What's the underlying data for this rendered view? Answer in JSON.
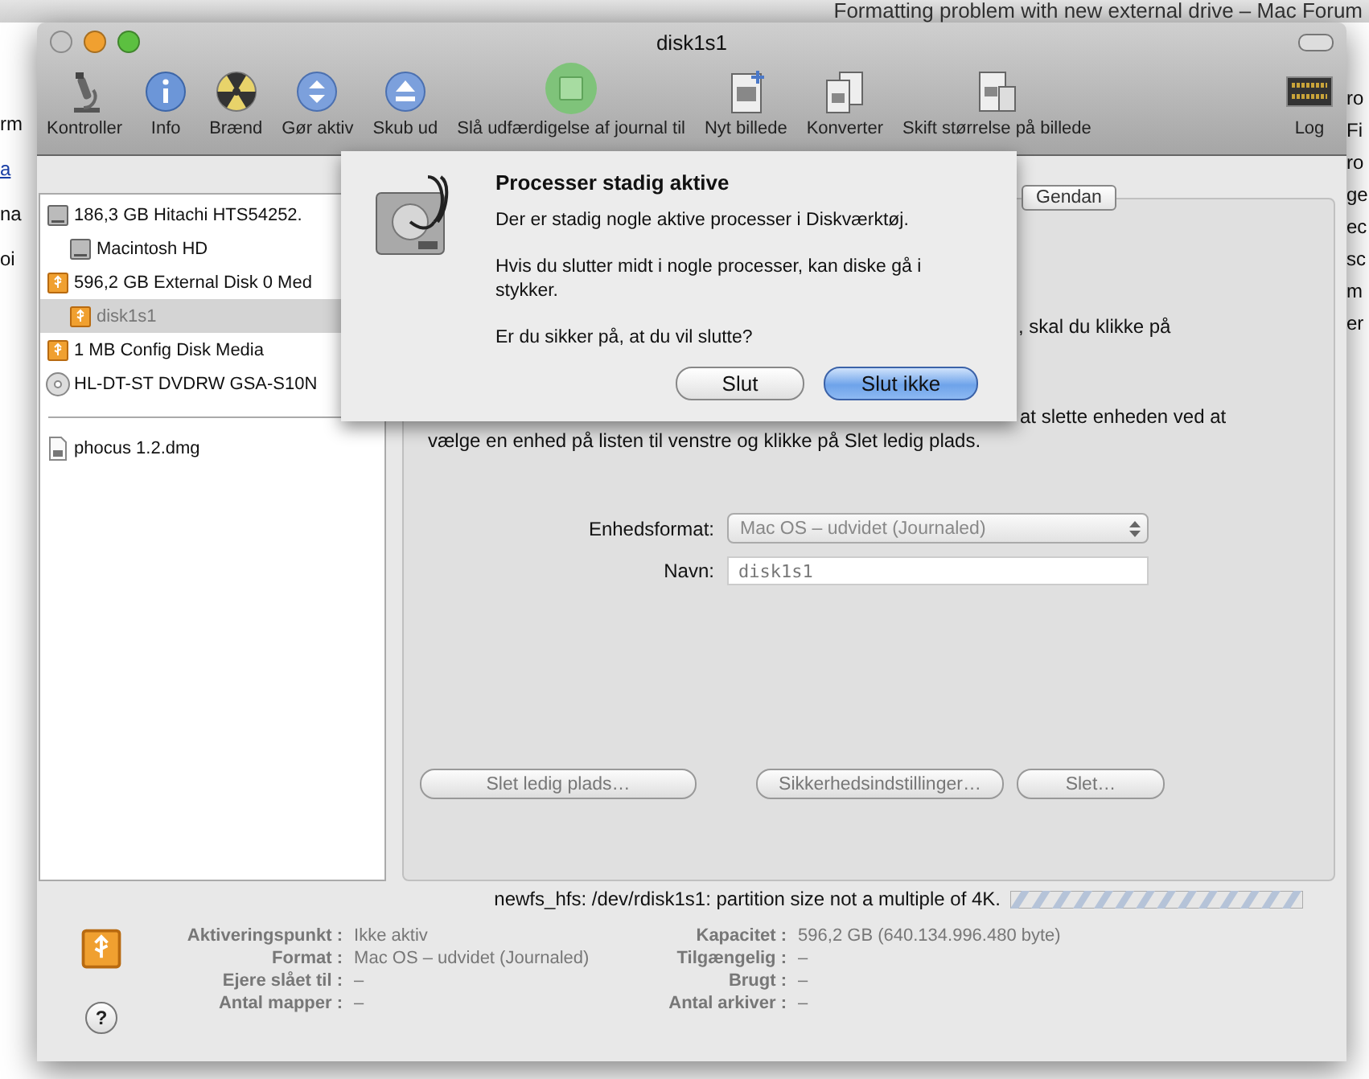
{
  "background_window": {
    "title": "Formatting problem with new external drive – Mac Forum",
    "left_fragments": [
      {
        "text": "rm",
        "kind": "text"
      },
      {
        "text": "a",
        "kind": "link"
      },
      {
        "text": "na",
        "kind": "text"
      },
      {
        "text": "oi",
        "kind": "text"
      }
    ],
    "right_fragments": [
      "ro",
      "Fi",
      "ro",
      "ge",
      "ec",
      "sc",
      "m",
      "er"
    ]
  },
  "window": {
    "title": "disk1s1"
  },
  "toolbar": [
    {
      "label": "Kontroller",
      "kind": "microscope"
    },
    {
      "label": "Info",
      "kind": "info"
    },
    {
      "label": "Brænd",
      "kind": "burn"
    },
    {
      "label": "Gør aktiv",
      "kind": "mount"
    },
    {
      "label": "Skub ud",
      "kind": "eject"
    },
    {
      "label": "Slå udfærdigelse af journal til",
      "kind": "journal"
    },
    {
      "label": "Nyt billede",
      "kind": "newimage"
    },
    {
      "label": "Konverter",
      "kind": "convert"
    },
    {
      "label": "Skift størrelse på billede",
      "kind": "resize"
    },
    {
      "label": "Log",
      "kind": "log"
    }
  ],
  "sidebar": {
    "items": [
      {
        "label": "186,3 GB Hitachi HTS54252.",
        "kind": "hdd",
        "selected": false,
        "children": [
          {
            "label": "Macintosh HD",
            "kind": "hdd",
            "selected": false
          }
        ]
      },
      {
        "label": "596,2 GB External Disk 0 Med",
        "kind": "usb",
        "selected": false,
        "children": [
          {
            "label": "disk1s1",
            "kind": "usb",
            "selected": true
          }
        ]
      },
      {
        "label": "1 MB Config Disk Media",
        "kind": "usb",
        "selected": false
      },
      {
        "label": "HL-DT-ST DVDRW GSA-S10N",
        "kind": "optical",
        "selected": false
      }
    ],
    "images": [
      {
        "label": "phocus 1.2.dmg",
        "kind": "dmg",
        "selected": false
      }
    ]
  },
  "tabs": [
    {
      "label": "Gendan",
      "selected": false
    }
  ],
  "panel": {
    "instruction_fragment": ", skal du klikke på",
    "note_lines": [
      "at slette enheden ved at",
      "vælge en enhed på listen til venstre og klikke på Slet ledig plads."
    ],
    "format_label": "Enhedsformat:",
    "format_value": "Mac OS – udvidet (Journaled)",
    "name_label": "Navn:",
    "name_value": "disk1s1",
    "buttons": [
      {
        "label": "Slet ledig plads…",
        "disabled": true
      },
      {
        "label": "Sikkerhedsindstillinger…",
        "disabled": true
      },
      {
        "label": "Slet…",
        "disabled": true
      }
    ]
  },
  "status": {
    "busy": true,
    "message": "newfs_hfs: /dev/rdisk1s1: partition size not a multiple of 4K."
  },
  "info": {
    "left": [
      "**Aktiveringspunkt :** Ikke aktiv",
      "**Format :** Mac OS – udvidet (Journaled)",
      "**Ejere slået til :** –",
      "**Antal mapper :** –"
    ],
    "right": [
      "**Kapacitet :** 596,2 GB (640.134.996.480 byte)",
      "**Tilgængelig :** –",
      "**Brugt :** –",
      "**Antal arkiver :** –"
    ],
    "help": "?"
  },
  "dialog": {
    "title": "Processer stadig aktive",
    "message": "Der er stadig nogle aktive processer i Diskværktøj.",
    "warning": "Hvis du slutter midt i nogle processer, kan diske gå i stykker.",
    "question": "Er du sikker på, at du vil slutte?",
    "buttons": [
      {
        "label": "Slut",
        "default": false
      },
      {
        "label": "Slut ikke",
        "default": true
      }
    ]
  }
}
